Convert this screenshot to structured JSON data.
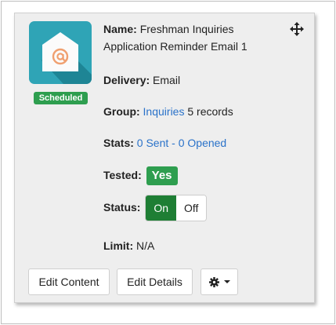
{
  "campaign": {
    "status_badge": "Scheduled",
    "name_label": "Name:",
    "name_value_line1": "Freshman Inquiries",
    "name_value_line2": "Application Reminder Email 1",
    "delivery_label": "Delivery:",
    "delivery_value": "Email",
    "group_label": "Group:",
    "group_link": "Inquiries",
    "group_records": "5 records",
    "stats_label": "Stats:",
    "stats_link": "0 Sent - 0 Opened",
    "tested_label": "Tested:",
    "tested_value": "Yes",
    "status_label": "Status:",
    "status_on": "On",
    "status_off": "Off",
    "status_selected": "On",
    "limit_label": "Limit:",
    "limit_value": "N/A"
  },
  "actions": {
    "edit_content": "Edit Content",
    "edit_details": "Edit Details"
  },
  "icons": {
    "move": "move-arrows-icon",
    "email": "email-at-icon",
    "gear": "gear-icon",
    "caret": "caret-down-icon"
  },
  "colors": {
    "icon_tile": "#2fa4b6",
    "badge_green": "#2e9e4f",
    "toggle_on": "#1e7e34",
    "link_blue": "#2a72c9",
    "email_at": "#f0a070"
  }
}
